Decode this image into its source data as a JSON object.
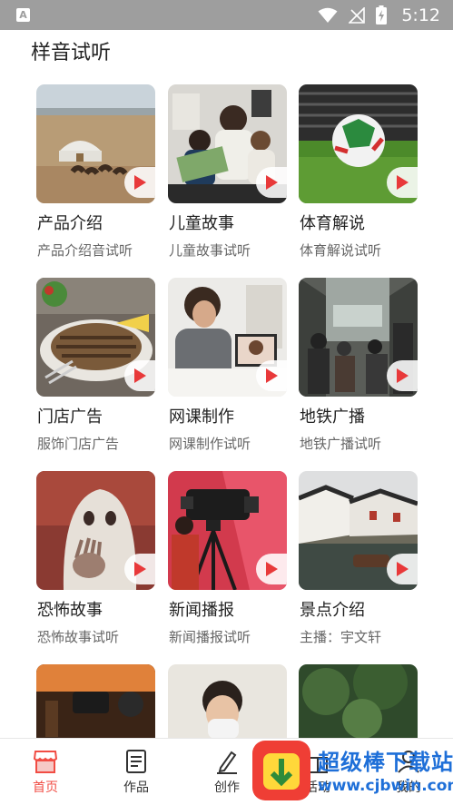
{
  "status_bar": {
    "time": "5:12",
    "app_icon_letter": "A"
  },
  "section": {
    "title": "样音试听"
  },
  "cards": [
    {
      "title": "产品介绍",
      "subtitle": "产品介绍音试听"
    },
    {
      "title": "儿童故事",
      "subtitle": "儿童故事试听"
    },
    {
      "title": "体育解说",
      "subtitle": "体育解说试听"
    },
    {
      "title": "门店广告",
      "subtitle": "服饰门店广告"
    },
    {
      "title": "网课制作",
      "subtitle": "网课制作试听"
    },
    {
      "title": "地铁广播",
      "subtitle": "地铁广播试听"
    },
    {
      "title": "恐怖故事",
      "subtitle": "恐怖故事试听"
    },
    {
      "title": "新闻播报",
      "subtitle": "新闻播报试听"
    },
    {
      "title": "景点介绍",
      "subtitle": "主播：宇文轩"
    }
  ],
  "tab_bar": {
    "items": [
      {
        "label": "首页",
        "active": true
      },
      {
        "label": "作品",
        "active": false
      },
      {
        "label": "创作",
        "active": false
      },
      {
        "label": "活动",
        "active": false
      },
      {
        "label": "我的",
        "active": false
      }
    ]
  },
  "watermark": {
    "text": "超级棒下载站",
    "url": "www.cjbwin.com"
  },
  "colors": {
    "accent": "#f14d44",
    "play_icon": "#e8393a",
    "status_bar": "#9e9e9e",
    "watermark_blue": "#1e6fd8"
  }
}
